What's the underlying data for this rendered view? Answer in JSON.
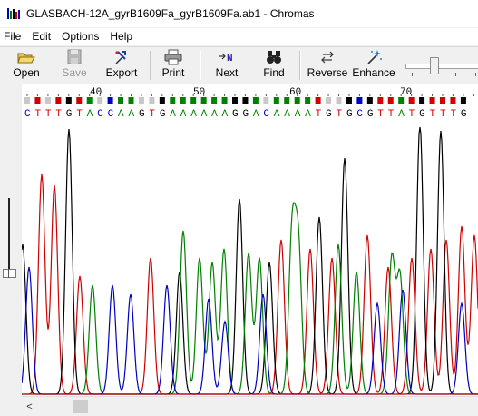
{
  "window": {
    "title": "GLASBACH-12A_gyrB1609Fa_gyrB1609Fa.ab1 - Chromas"
  },
  "menu": [
    {
      "label": "File"
    },
    {
      "label": "Edit"
    },
    {
      "label": "Options"
    },
    {
      "label": "Help"
    }
  ],
  "toolbar": {
    "open": "Open",
    "save": "Save",
    "export": "Export",
    "print": "Print",
    "next": "Next",
    "find": "Find",
    "reverse": "Reverse",
    "enhance": "Enhance"
  },
  "ruler": {
    "ticks": [
      "40",
      "50",
      "60",
      "70"
    ]
  },
  "sequence": {
    "bases": "CTTTGTACCAAGTGAAAAAAGGACAAAATGTGCGTTATGTTTG",
    "quality": "-+-++++-+++--++++++++++-+++++--++++++++++++-"
  },
  "colors": {
    "A": "#008000",
    "C": "#0000c0",
    "G": "#000000",
    "T": "#d00000",
    "N": "#c8c8c8"
  },
  "icons": {
    "open": "folder-open-icon",
    "save": "floppy-disk-icon",
    "export": "export-icon",
    "print": "printer-icon",
    "next": "next-n-icon",
    "find": "binoculars-icon",
    "reverse": "reverse-icon",
    "enhance": "enhance-wand-icon"
  },
  "scrollbar": {
    "left_arrow": "<"
  }
}
